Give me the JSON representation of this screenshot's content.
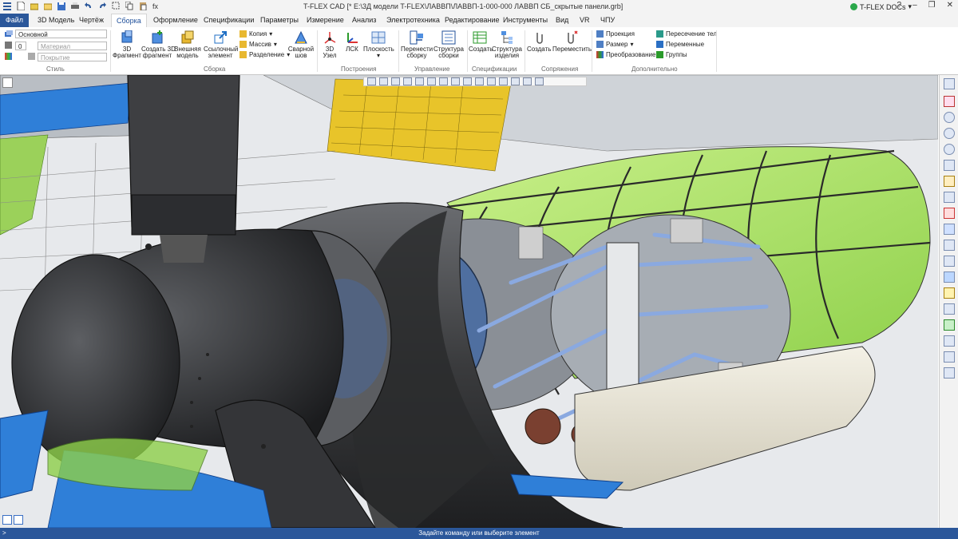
{
  "window": {
    "title": "T-FLEX CAD [* E:\\3Д модели T-FLEX\\ЛАВВП\\ЛАВВП-1-000-000 ЛАВВП СБ_скрытые панели.grb]",
    "docs_label": "T-FLEX DOCs"
  },
  "menu": {
    "file": "Файл",
    "tabs": [
      "3D Модель",
      "Чертёж",
      "Сборка",
      "Оформление",
      "Спецификации",
      "Параметры",
      "Измерение",
      "Анализ",
      "Электротехника",
      "Редактирование",
      "Инструменты",
      "Вид",
      "VR",
      "ЧПУ"
    ],
    "active_tab": "Сборка"
  },
  "ribbon": {
    "style": {
      "label": "Стиль",
      "layer": "Основной",
      "material_num": "0",
      "material_ph": "Материал",
      "coating_ph": "Покрытие"
    },
    "assembly": {
      "label": "Сборка",
      "fragment3d": "3D\nФрагмент",
      "create_fragment": "Создать 3D\nфрагмент",
      "external_model": "Внешняя\nмодель",
      "ref_element": "Ссылочный\nэлемент",
      "copy": "Копия",
      "array": "Массив",
      "split": "Разделение",
      "weld": "Сварной\nшов"
    },
    "construct": {
      "label": "Построения",
      "node3d": "3D\nУзел",
      "lcs": "ЛСК",
      "plane": "Плоскость"
    },
    "manage": {
      "label": "Управление",
      "move_assembly": "Перенести\nсборку",
      "assembly_structure": "Структура\nсборки"
    },
    "spec": {
      "label": "Спецификации",
      "create": "Создать",
      "product_structure": "Структура\nизделия"
    },
    "mates": {
      "label": "Сопряжения",
      "create": "Создать",
      "move": "Переместить"
    },
    "extra": {
      "label": "Дополнительно",
      "projection": "Проекция",
      "size": "Размер",
      "transform": "Преобразование",
      "body_intersection": "Пересечение тел",
      "variables": "Переменные",
      "groups": "Группы"
    }
  },
  "status": {
    "prompt": ">",
    "message": "Задайте команду или выберите элемент"
  },
  "colors": {
    "accent": "#2b579a",
    "hull": "#3a3b3d",
    "canopy": "#8ed04a",
    "wing_blue": "#2f7fd8",
    "wing_yellow": "#e8c42a",
    "strut_blue": "#8aa9e0"
  }
}
